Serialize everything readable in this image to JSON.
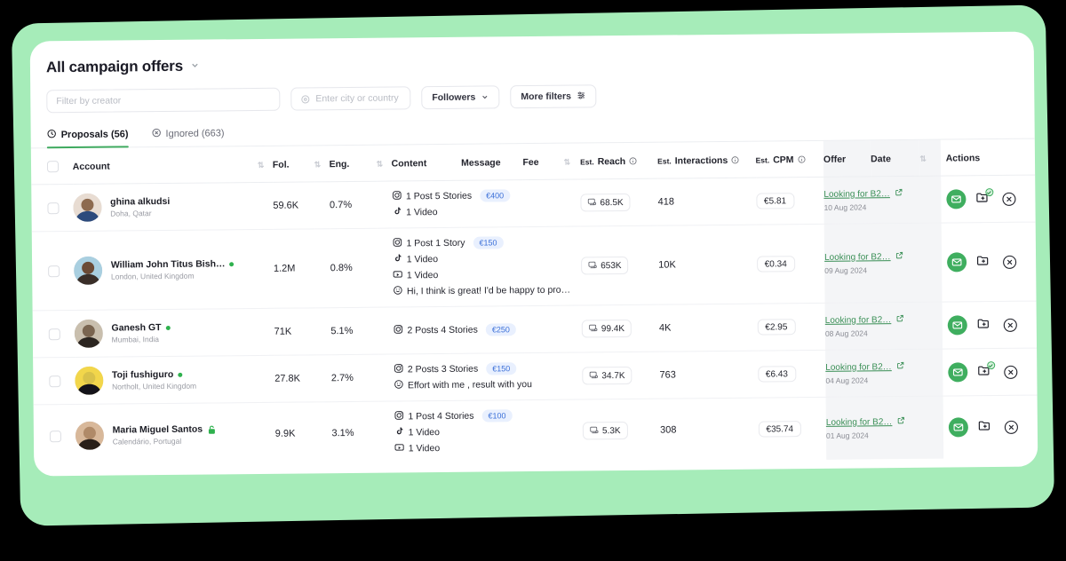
{
  "header": {
    "title": "All campaign offers",
    "title_chevron": "chevron-down-icon"
  },
  "filters": {
    "creator_placeholder": "Filter by creator",
    "creator_value": "",
    "city_placeholder": "Enter city or country",
    "city_value": "",
    "followers_label": "Followers",
    "more_filters_label": "More filters"
  },
  "tabs": [
    {
      "label": "Proposals (56)",
      "icon": "clock-icon",
      "active": true
    },
    {
      "label": "Ignored (663)",
      "icon": "circle-x-icon",
      "active": false
    }
  ],
  "table": {
    "columns": {
      "account": "Account",
      "fol": "Fol.",
      "eng": "Eng.",
      "content": "Content",
      "message": "Message",
      "fee": "Fee",
      "est_reach_prefix": "Est.",
      "est_reach": "Reach",
      "est_interactions_prefix": "Est.",
      "est_interactions": "Interactions",
      "est_cpm_prefix": "Est.",
      "est_cpm": "CPM",
      "offer": "Offer",
      "date": "Date",
      "actions": "Actions"
    },
    "rows": [
      {
        "name": "ghina alkudsi",
        "location": "Doha, Qatar",
        "online": false,
        "lock": false,
        "name_bold": true,
        "avatar_colors": [
          "#e8dcd2",
          "#2c4a7c",
          "#8d6a4f"
        ],
        "fol": "59.6K",
        "eng": "0.7%",
        "content": [
          {
            "icon": "instagram-icon",
            "text": "1 Post  5 Stories",
            "fee": "€400"
          },
          {
            "icon": "tiktok-icon",
            "text": "1 Video",
            "fee": ""
          }
        ],
        "reach": "68.5K",
        "interactions": "418",
        "cpm": "€5.81",
        "offer_label": "Looking for B2…",
        "offer_date": "10 Aug 2024",
        "folder_checked": true
      },
      {
        "name": "William John Titus Bish…",
        "location": "London, United Kingdom",
        "online": true,
        "lock": false,
        "name_bold": true,
        "avatar_colors": [
          "#a9cfe0",
          "#3a2e28",
          "#6b4a35"
        ],
        "fol": "1.2M",
        "eng": "0.8%",
        "content": [
          {
            "icon": "instagram-icon",
            "text": "1 Post  1 Story",
            "fee": "€150"
          },
          {
            "icon": "tiktok-icon",
            "text": "1 Video",
            "fee": ""
          },
          {
            "icon": "youtube-icon",
            "text": "1 Video",
            "fee": ""
          },
          {
            "icon": "message-icon",
            "text": "Hi, I think is great! I'd be happy to pro…",
            "fee": ""
          }
        ],
        "reach": "653K",
        "interactions": "10K",
        "cpm": "€0.34",
        "offer_label": "Looking for B2…",
        "offer_date": "09 Aug 2024",
        "folder_checked": false
      },
      {
        "name": "Ganesh GT",
        "location": "Mumbai, India",
        "online": true,
        "lock": false,
        "name_bold": true,
        "avatar_colors": [
          "#c9bfae",
          "#2b2520",
          "#7a6550"
        ],
        "fol": "71K",
        "eng": "5.1%",
        "content": [
          {
            "icon": "instagram-icon",
            "text": "2 Posts  4 Stories",
            "fee": "€250"
          }
        ],
        "reach": "99.4K",
        "interactions": "4K",
        "cpm": "€2.95",
        "offer_label": "Looking for B2…",
        "offer_date": "08 Aug 2024",
        "folder_checked": false
      },
      {
        "name": "Toji fushiguro",
        "location": "Northolt, United Kingdom",
        "online": true,
        "lock": false,
        "name_bold": true,
        "avatar_colors": [
          "#f2d64b",
          "#14131a",
          "#d9c24a"
        ],
        "fol": "27.8K",
        "eng": "2.7%",
        "content": [
          {
            "icon": "instagram-icon",
            "text": "2 Posts  3 Stories",
            "fee": "€150"
          },
          {
            "icon": "message-icon",
            "text": "Effort with me , result with you",
            "fee": ""
          }
        ],
        "reach": "34.7K",
        "interactions": "763",
        "cpm": "€6.43",
        "offer_label": "Looking for B2…",
        "offer_date": "04 Aug 2024",
        "folder_checked": true
      },
      {
        "name": "Maria Miguel Santos",
        "location": "Calendário, Portugal",
        "online": false,
        "lock": true,
        "name_bold": true,
        "avatar_colors": [
          "#d8b89a",
          "#2a1f18",
          "#b08a68"
        ],
        "fol": "9.9K",
        "eng": "3.1%",
        "content": [
          {
            "icon": "instagram-icon",
            "text": "1 Post  4 Stories",
            "fee": "€100"
          },
          {
            "icon": "tiktok-icon",
            "text": "1 Video",
            "fee": ""
          },
          {
            "icon": "youtube-icon",
            "text": "1 Video",
            "fee": ""
          }
        ],
        "reach": "5.3K",
        "interactions": "308",
        "cpm": "€35.74",
        "offer_label": "Looking for B2…",
        "offer_date": "01 Aug 2024",
        "folder_checked": false
      }
    ]
  },
  "colors": {
    "accent_green": "#3fae5f",
    "card_green": "#a6ecb9",
    "fee_pill_bg": "#e9f0fe",
    "fee_pill_text": "#3a6fd8",
    "background": "#000000"
  }
}
